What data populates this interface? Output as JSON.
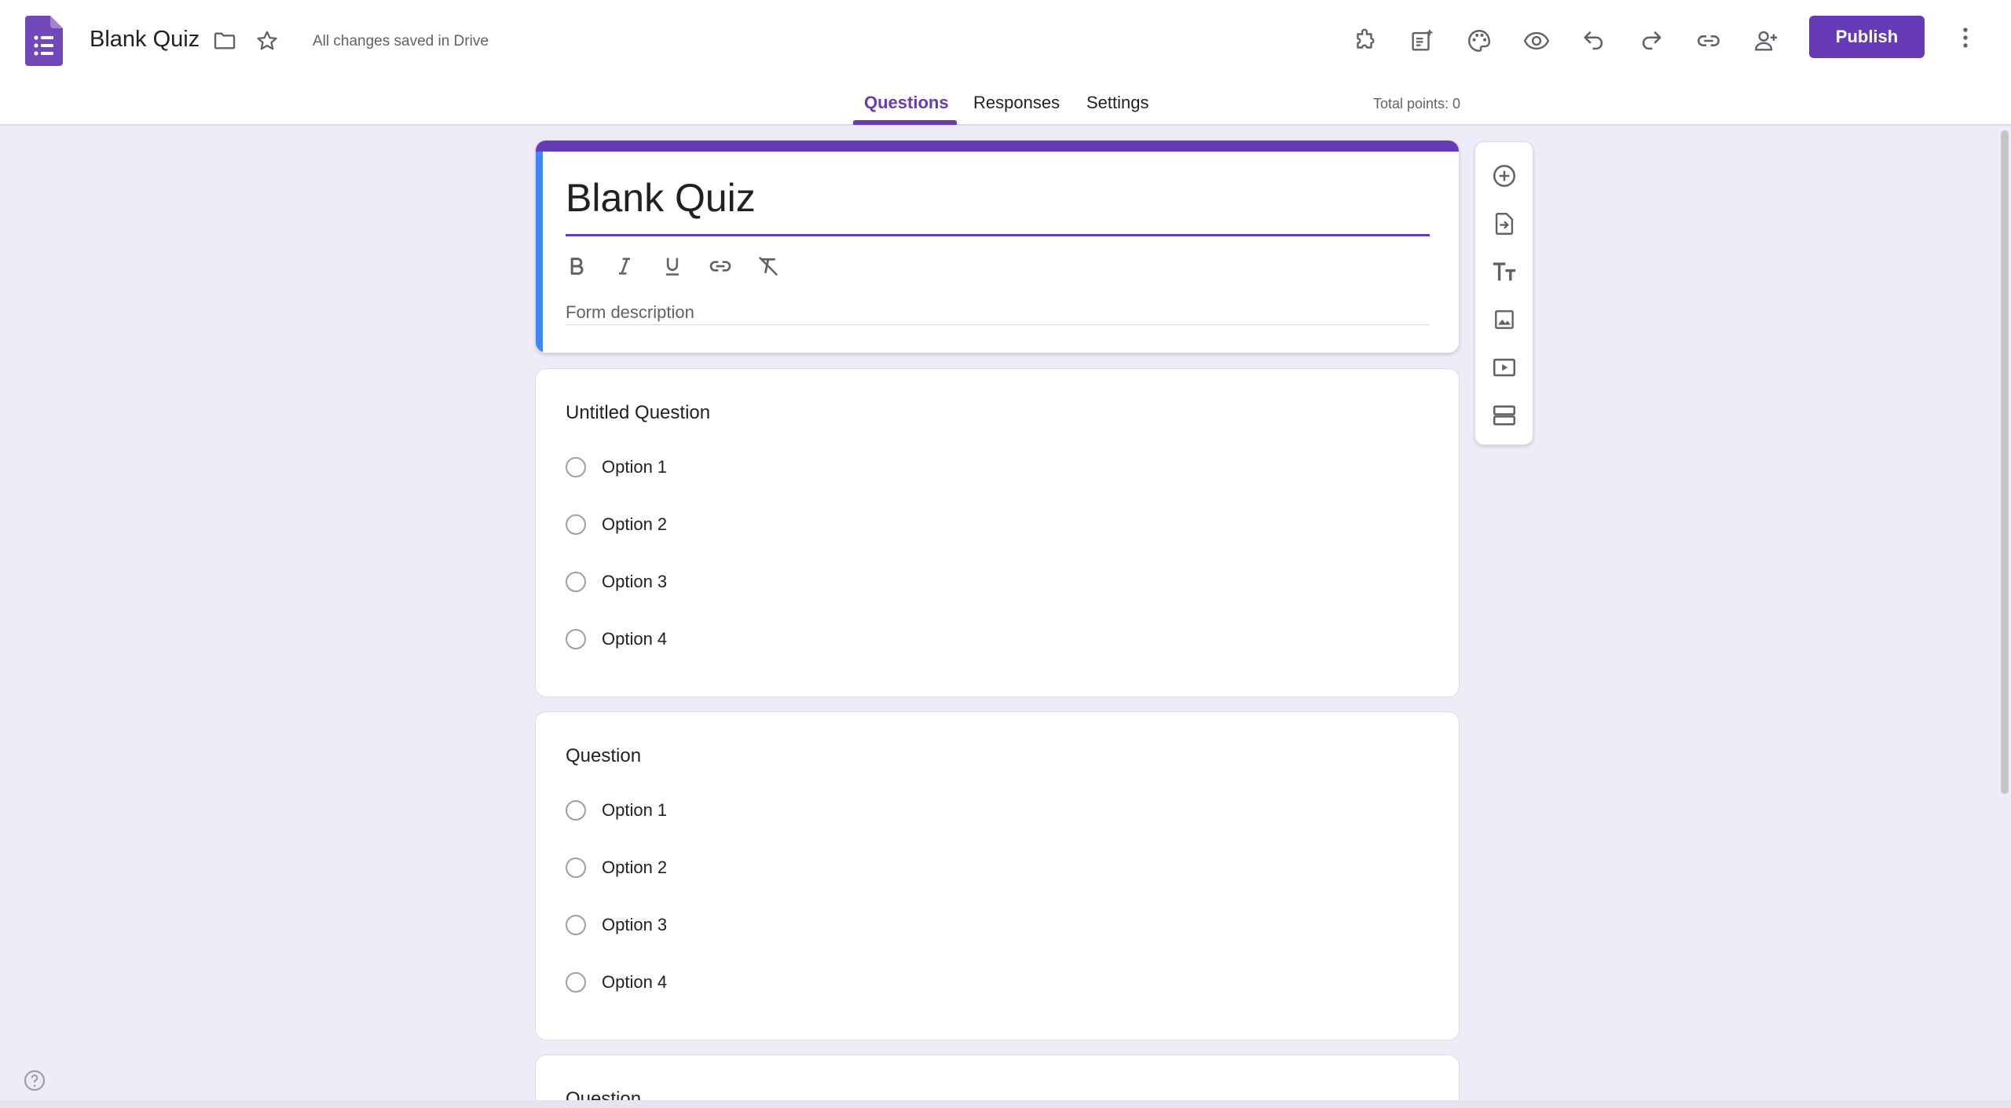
{
  "app": {
    "doc_title": "Blank Quiz",
    "save_status": "All changes saved in Drive",
    "logo_icon": "google-forms-logo-icon",
    "brand_color": "#673ab7"
  },
  "toolbar": {
    "icons": [
      "add-ons-icon",
      "customize-form-icon",
      "palette-icon",
      "preview-eye-icon",
      "undo-icon",
      "redo-icon",
      "copy-link-icon",
      "add-collaborator-icon"
    ],
    "publish_label": "Publish",
    "more_icon": "more-vert-icon"
  },
  "tabs": [
    {
      "label": "Questions",
      "active": true
    },
    {
      "label": "Responses",
      "active": false
    },
    {
      "label": "Settings",
      "active": false
    }
  ],
  "total_points": "Total points: 0",
  "form": {
    "title": "Blank Quiz",
    "description_placeholder": "Form description",
    "format_icons": [
      "bold-icon",
      "italic-icon",
      "underline-icon",
      "link-icon",
      "clear-format-icon"
    ]
  },
  "questions": [
    {
      "title": "Untitled Question",
      "options": [
        "Option 1",
        "Option 2",
        "Option 3",
        "Option 4"
      ]
    },
    {
      "title": "Question",
      "options": [
        "Option 1",
        "Option 2",
        "Option 3",
        "Option 4"
      ]
    },
    {
      "title": "Question",
      "options": []
    }
  ],
  "side_toolbar": [
    "add-question-icon",
    "import-questions-icon",
    "add-title-text-icon",
    "add-image-icon",
    "add-video-icon",
    "add-section-icon"
  ],
  "help_icon": "help-icon"
}
